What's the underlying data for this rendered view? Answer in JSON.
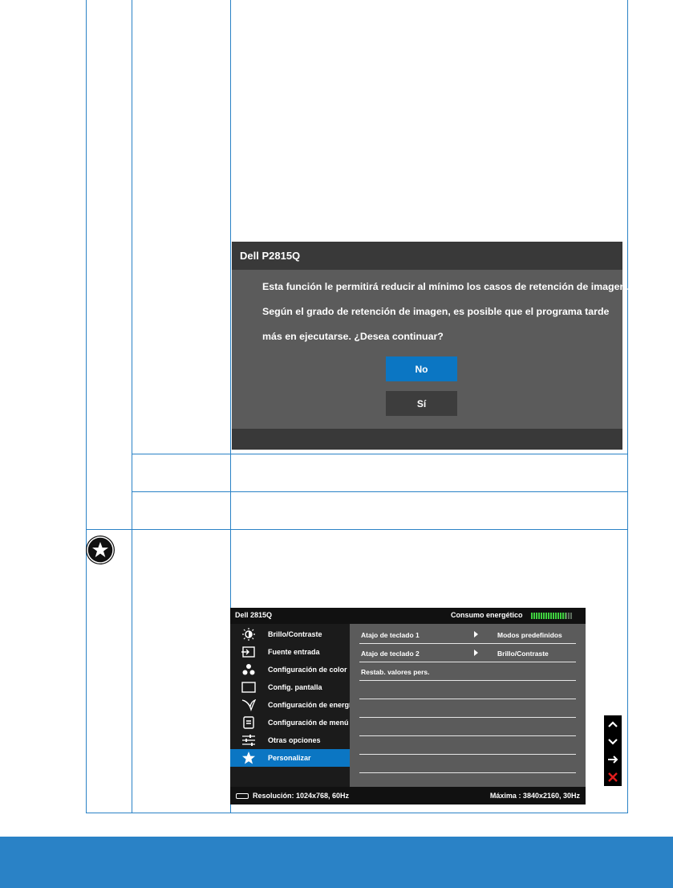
{
  "dialog": {
    "title": "Dell P2815Q",
    "lines": [
      "Esta función le permitirá reducir al mínimo los casos de retención de imagen.",
      "Según el grado de retención de imagen, es posible que el programa tarde",
      "más en ejecutarse. ¿Desea continuar?"
    ],
    "no_label": "No",
    "si_label": "Sí"
  },
  "badge": {
    "icon": "star-icon"
  },
  "osd": {
    "model": "Dell 2815Q",
    "energy_label": "Consumo energético",
    "energy_level": 0.83,
    "menu": [
      {
        "icon": "brightness-icon",
        "label": "Brillo/Contraste"
      },
      {
        "icon": "input-source-icon",
        "label": "Fuente entrada"
      },
      {
        "icon": "color-dots-icon",
        "label": "Configuración de color"
      },
      {
        "icon": "display-icon",
        "label": "Config. pantalla"
      },
      {
        "icon": "energy-leaf-icon",
        "label": "Configuración de energía"
      },
      {
        "icon": "menu-settings-icon",
        "label": "Configuración de menú"
      },
      {
        "icon": "sliders-icon",
        "label": "Otras opciones"
      },
      {
        "icon": "star-icon",
        "label": "Personalizar",
        "selected": true
      }
    ],
    "rows": [
      {
        "label": "Atajo de teclado 1",
        "value": "Modos predefinidos"
      },
      {
        "label": "Atajo de teclado 2",
        "value": "Brillo/Contraste"
      },
      {
        "label": "Restab. valores pers.",
        "value": ""
      },
      {
        "label": "",
        "value": ""
      },
      {
        "label": "",
        "value": ""
      },
      {
        "label": "",
        "value": ""
      },
      {
        "label": "",
        "value": ""
      },
      {
        "label": "",
        "value": ""
      }
    ],
    "resolution": "Resolución: 1024x768,  60Hz",
    "maximum": "Máxima : 3840x2160,  30Hz"
  },
  "nav": {
    "up": "^",
    "down": "v",
    "right": "→",
    "close": "✕",
    "close_color": "#e11d1d"
  },
  "colors": {
    "accent": "#2a82c6",
    "osd_select": "#0b76c3"
  }
}
